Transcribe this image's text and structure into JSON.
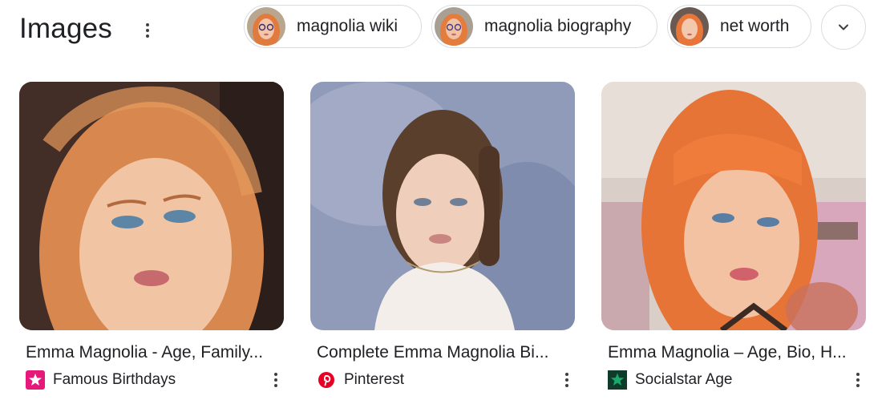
{
  "header": {
    "title": "Images",
    "chips": [
      {
        "label": "magnolia wiki",
        "thumb_icon": "portrait-thumbnail-glasses"
      },
      {
        "label": "magnolia biography",
        "thumb_icon": "portrait-thumbnail-glasses"
      },
      {
        "label": "net worth",
        "thumb_icon": "portrait-thumbnail"
      }
    ],
    "expand_icon": "chevron-down-icon"
  },
  "results": [
    {
      "title": "Emma Magnolia - Age, Family...",
      "source": "Famous Birthdays",
      "source_icon": "famous-birthdays-star-icon",
      "source_color": "#e6197a"
    },
    {
      "title": "Complete Emma Magnolia Bi...",
      "source": "Pinterest",
      "source_icon": "pinterest-icon",
      "source_color": "#e60023"
    },
    {
      "title": "Emma Magnolia – Age, Bio, H...",
      "source": "Socialstar Age",
      "source_icon": "socialstar-age-icon",
      "source_color": "#1aa86b"
    }
  ],
  "colors": {
    "text": "#202124",
    "border": "#dadce0",
    "hair_red": "#e27640"
  }
}
